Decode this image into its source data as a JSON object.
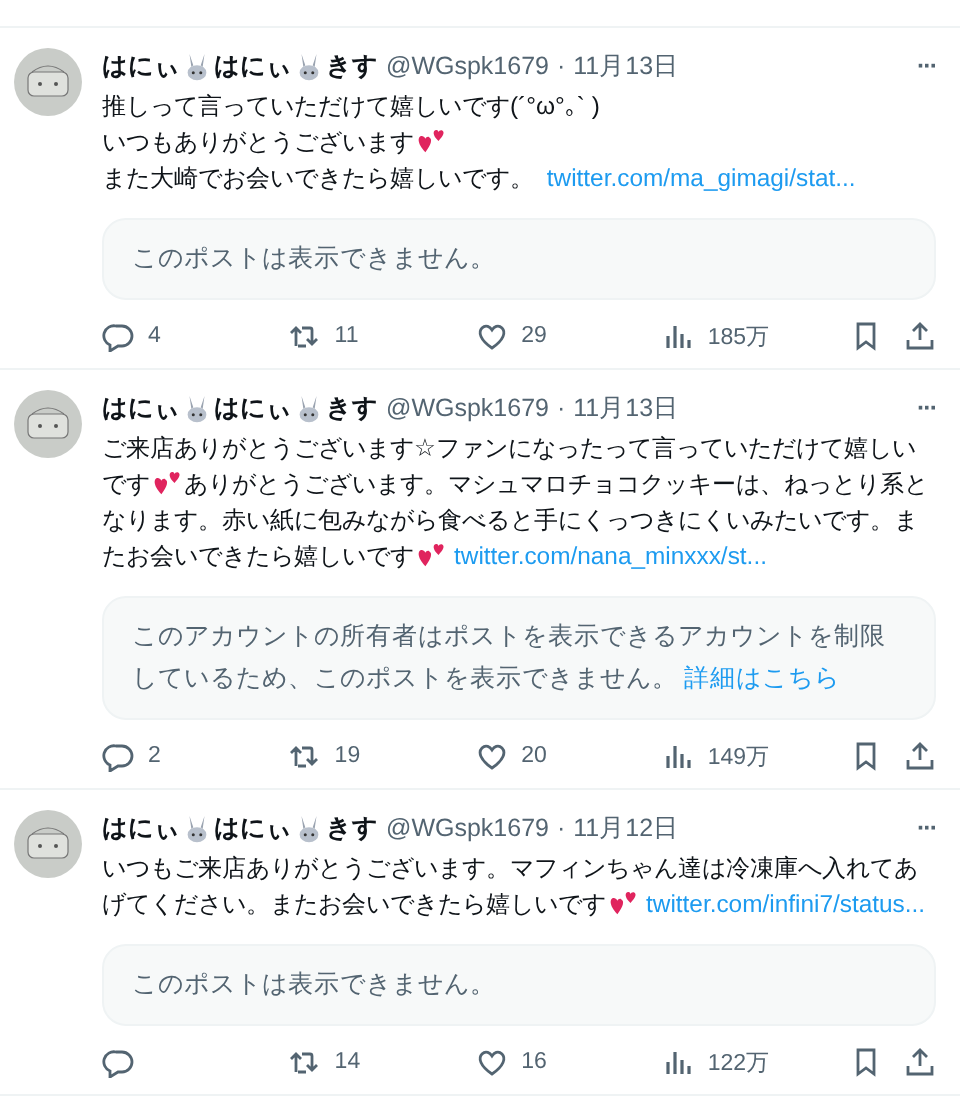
{
  "tweets": [
    {
      "name": [
        {
          "kind": "text",
          "text": "はにぃ"
        },
        {
          "kind": "rabbit"
        },
        {
          "kind": "text",
          "text": "はにぃ"
        },
        {
          "kind": "rabbit"
        },
        {
          "kind": "text",
          "text": "きす"
        }
      ],
      "handle": "@WGspk1679",
      "separator": "·",
      "date": "11月13日",
      "more": "···",
      "body": [
        {
          "kind": "text",
          "text": "推しって言っていただけて嬉しいです(´°ω°｡` )\nいつもありがとうございます"
        },
        {
          "kind": "heart"
        },
        {
          "kind": "text",
          "text": "\nまた大崎でお会いできたら嬉しいです。 "
        },
        {
          "kind": "link",
          "text": "twitter.com/ma_gimagi/stat..."
        }
      ],
      "quote": [
        {
          "kind": "text",
          "text": "このポストは表示できません。"
        }
      ],
      "actions": {
        "replies": "4",
        "reposts": "11",
        "likes": "29",
        "views": "185万"
      }
    },
    {
      "name": [
        {
          "kind": "text",
          "text": "はにぃ"
        },
        {
          "kind": "rabbit"
        },
        {
          "kind": "text",
          "text": "はにぃ"
        },
        {
          "kind": "rabbit"
        },
        {
          "kind": "text",
          "text": "きす"
        }
      ],
      "handle": "@WGspk1679",
      "separator": "·",
      "date": "11月13日",
      "more": "···",
      "body": [
        {
          "kind": "text",
          "text": "ご来店ありがとうございます☆ファンになったって言っていただけて嬉しいです"
        },
        {
          "kind": "heart"
        },
        {
          "kind": "text",
          "text": "ありがとうございます。マシュマロチョコクッキーは、ねっとり系となります。赤い紙に包みながら食べると手にくっつきにくいみたいです。またお会いできたら嬉しいです"
        },
        {
          "kind": "heart"
        },
        {
          "kind": "link",
          "text": "twitter.com/nana_minxxx/st..."
        }
      ],
      "quote": [
        {
          "kind": "text",
          "text": "このアカウントの所有者はポストを表示できるアカウントを制限しているため、このポストを表示できません。"
        },
        {
          "kind": "link",
          "text": "詳細はこちら"
        }
      ],
      "actions": {
        "replies": "2",
        "reposts": "19",
        "likes": "20",
        "views": "149万"
      }
    },
    {
      "name": [
        {
          "kind": "text",
          "text": "はにぃ"
        },
        {
          "kind": "rabbit"
        },
        {
          "kind": "text",
          "text": "はにぃ"
        },
        {
          "kind": "rabbit"
        },
        {
          "kind": "text",
          "text": "きす"
        }
      ],
      "handle": "@WGspk1679",
      "separator": "·",
      "date": "11月12日",
      "more": "···",
      "body": [
        {
          "kind": "text",
          "text": "いつもご来店ありがとうございます。マフィンちゃん達は冷凍庫へ入れてあげてください。またお会いできたら嬉しいです"
        },
        {
          "kind": "heart"
        },
        {
          "kind": "link",
          "text": "twitter.com/infini7/status..."
        }
      ],
      "quote": [
        {
          "kind": "text",
          "text": "このポストは表示できません。"
        }
      ],
      "actions": {
        "reposts": "14",
        "likes": "16",
        "views": "122万"
      }
    }
  ]
}
